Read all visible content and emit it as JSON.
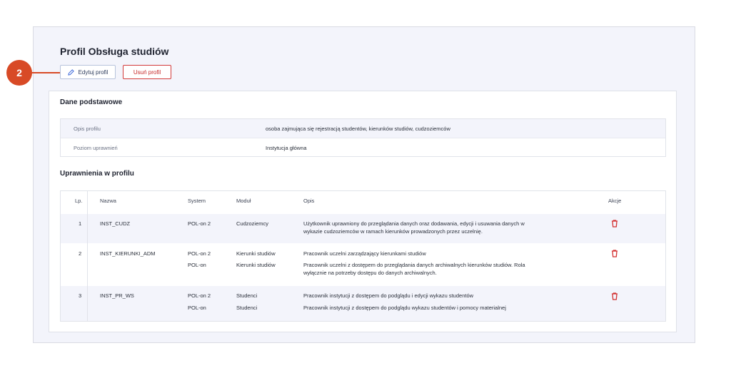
{
  "page": {
    "title": "Profil Obsługa studiów",
    "badge": "2",
    "buttons": {
      "edit": "Edytuj profil",
      "delete": "Usuń profil"
    }
  },
  "basic": {
    "title": "Dane podstawowe",
    "rows": [
      {
        "label": "Opis profilu",
        "value": "osoba zajmująca się rejestracją studentów, kierunków studiów, cudzoziemców"
      },
      {
        "label": "Poziom uprawnień",
        "value": "Instytucja główna"
      }
    ]
  },
  "permissions": {
    "title": "Uprawnienia w profilu",
    "headers": {
      "lp": "Lp.",
      "name": "Nazwa",
      "system": "System",
      "module": "Moduł",
      "desc": "Opis",
      "actions": "Akcje"
    },
    "rows": [
      {
        "lp": "1",
        "name": "INST_CUDZ",
        "system1": "POL-on 2",
        "module1": "Cudzoziemcy",
        "desc1a": "Użytkownik uprawniony do przeglądania danych oraz dodawania, edycji i usuwania danych w",
        "desc1b": "wykazie cudzoziemców w ramach kierunków prowadzonych przez uczelnię."
      },
      {
        "lp": "2",
        "name": "INST_KIERUNKI_ADM",
        "system1": "POL-on 2",
        "module1": "Kierunki studiów",
        "desc1a": "Pracownik uczelni zarządzający kierunkami studiów",
        "system2": "POL-on",
        "module2": "Kierunki studiów",
        "desc2a": "Pracownik uczelni z dostępem do przeglądania danych archiwalnych kierunków studiów. Rola",
        "desc2b": "wyłącznie na potrzeby dostępu do danych archiwalnych."
      },
      {
        "lp": "3",
        "name": "INST_PR_WS",
        "system1": "POL-on 2",
        "module1": "Studenci",
        "desc1a": "Pracownik instytucji z dostępem do podglądu i edycji wykazu studentów",
        "system2": "POL-on",
        "module2": "Studenci",
        "desc2a": "Pracownik instytucji z dostępem do podglądu wykazu studentów i pomocy materialnej"
      }
    ]
  },
  "colors": {
    "accent": "#d84a26",
    "danger": "#d32f2f",
    "stripe": "#f3f4fb"
  }
}
